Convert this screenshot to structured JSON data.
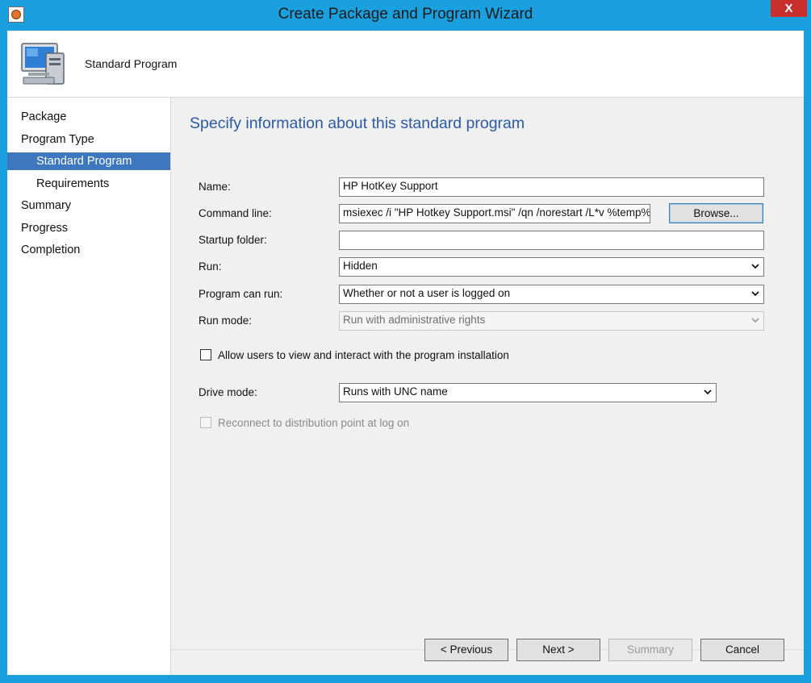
{
  "window": {
    "title": "Create Package and Program Wizard",
    "close_label": "X"
  },
  "header": {
    "title": "Standard Program"
  },
  "nav": {
    "items": [
      {
        "label": "Package"
      },
      {
        "label": "Program Type"
      },
      {
        "label": "Standard Program",
        "active": true
      },
      {
        "label": "Requirements"
      },
      {
        "label": "Summary"
      },
      {
        "label": "Progress"
      },
      {
        "label": "Completion"
      }
    ]
  },
  "form": {
    "heading": "Specify information about this standard program",
    "name_label": "Name:",
    "name_value": "HP HotKey Support",
    "cmd_label": "Command line:",
    "cmd_value": "msiexec /i \"HP Hotkey Support.msi\" /qn /norestart /L*v %temp%",
    "browse_label": "Browse...",
    "startup_label": "Startup folder:",
    "startup_value": "",
    "run_label": "Run:",
    "run_value": "Hidden",
    "can_run_label": "Program can run:",
    "can_run_value": "Whether or not a user is logged on",
    "run_mode_label": "Run mode:",
    "run_mode_value": "Run with administrative rights",
    "allow_label": "Allow users to view and interact with the program installation",
    "drive_label": "Drive mode:",
    "drive_value": "Runs with UNC name",
    "reconnect_label": "Reconnect to distribution point at log on"
  },
  "footer": {
    "previous_label": "< Previous",
    "next_label": "Next >",
    "summary_label": "Summary",
    "cancel_label": "Cancel"
  }
}
